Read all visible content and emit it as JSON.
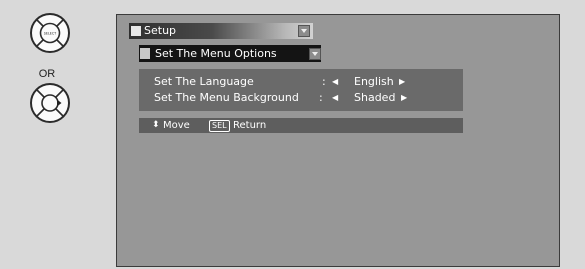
{
  "remote": {
    "select_button_text": "SELECT",
    "or_label": "OR"
  },
  "menu": {
    "title": "Setup",
    "submenu": "Set The Menu Options",
    "options": [
      {
        "name": "Set The Language",
        "colon": ":",
        "value": "English"
      },
      {
        "name": "Set The Menu Background",
        "colon": ":",
        "value": "Shaded"
      }
    ]
  },
  "help": {
    "move_label": "Move",
    "sel_key": "SEL",
    "return_label": "Return"
  },
  "colors": {
    "screen_bg": "#979797",
    "options_bg": "#6a6a6a",
    "submenu_bg": "#141414"
  }
}
